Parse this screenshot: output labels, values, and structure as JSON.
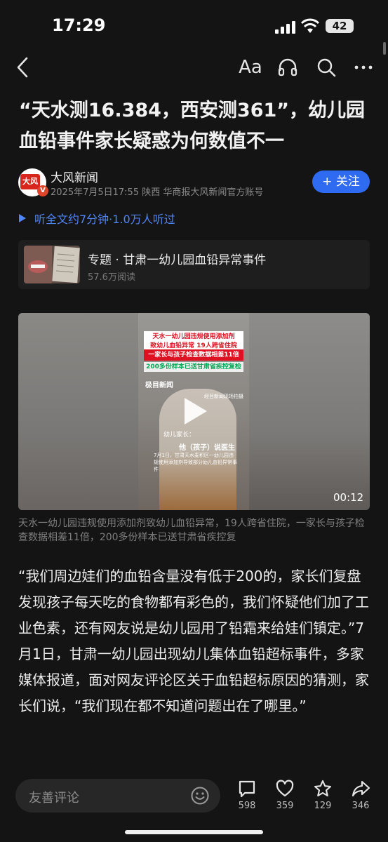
{
  "status_bar": {
    "time": "17:29",
    "battery": "42"
  },
  "nav": {
    "font_label": "Aa"
  },
  "article": {
    "title": "“天水测16.384，西安测361”，幼儿园血铅事件家长疑惑为何数值不一",
    "author": {
      "name": "大风新闻",
      "avatar_text": "大风",
      "badge": "V",
      "meta": "2025年7月5日17:55 陕西 华商报大风新闻官方账号",
      "follow_label": "+ 关注"
    },
    "listen_label": "听全文约7分钟·1.0万人听过",
    "topic": {
      "title": "专题 · 甘肃一幼儿园血铅异常事件",
      "reads": "57.6万阅读"
    },
    "video": {
      "duration": "00:12",
      "caption_line1": "天水一幼儿园违规使用添加剂",
      "caption_line2": "致幼儿血铅异常 19人跨省住院",
      "caption_line3": "一家长与孩子检查数据相差11倍",
      "caption_line4": "200多份样本已送甘肃省疾控复检",
      "brand": "极目新闻",
      "source": "经目新闻现场拍摄",
      "overlay_1": "幼儿家长：",
      "overlay_2": "他（孩子）说医生",
      "overlay_3": "7月1日，甘肃天水麦积区一幼儿园违规使用添加剂导致部分幼儿血铅异常事件"
    },
    "video_caption": "天水一幼儿园违规使用添加剂致幼儿血铅异常，19人跨省住院，一家长与孩子检查数据相差11倍，200多份样本已送甘肃省疾控复",
    "body": "“我们周边娃们的血铅含量没有低于200的，家长们复盘发现孩子每天吃的食物都有彩色的，我们怀疑他们加了工业色素，还有网友说是幼儿园用了铅霜来给娃们镇定。”7月1日，甘肃一幼儿园出现幼儿集体血铅超标事件，多家媒体报道，面对网友评论区关于血铅超标原因的猜测，家长们说，“我们现在都不知道问题出在了哪里。”"
  },
  "bottom_bar": {
    "comment_placeholder": "友善评论",
    "comments": "598",
    "likes": "359",
    "favorites": "129",
    "shares": "346"
  },
  "colors": {
    "accent": "#2f6bf0",
    "link": "#4f86f7",
    "background": "#141414"
  },
  "icons": [
    "back-icon",
    "font-size-icon",
    "headphones-icon",
    "search-icon",
    "more-icon",
    "play-icon",
    "emoji-icon",
    "comment-icon",
    "heart-icon",
    "star-icon",
    "share-icon"
  ]
}
